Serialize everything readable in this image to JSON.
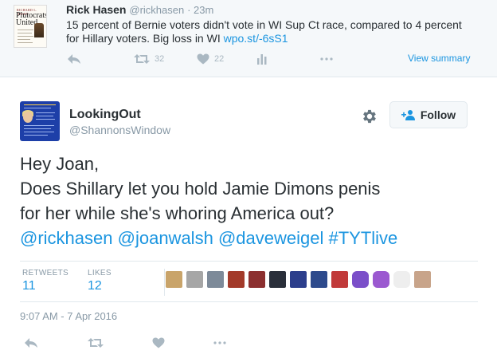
{
  "parent_tweet": {
    "avatar": {
      "author_line": "RICHARD L. HASEN",
      "title": "Plutocrats United"
    },
    "name": "Rick Hasen",
    "handle": "@rickhasen",
    "time": "· 23m",
    "text_line1": "15 percent of Bernie voters didn't vote in WI Sup Ct race, compared to 4 percent",
    "text_line2_prefix": "for Hillary voters. Big loss in WI ",
    "link": "wpo.st/-6sS1",
    "retweet_count": "32",
    "like_count": "22",
    "view_summary": "View summary",
    "icons": [
      "reply-icon",
      "retweet-icon",
      "like-icon",
      "analytics-icon",
      "more-icon"
    ]
  },
  "tweet": {
    "name": "LookingOut",
    "handle": "@ShannonsWindow",
    "follow_label": "Follow",
    "text_line1": "Hey Joan,",
    "text_line2": "Does Shillary let you hold Jamie Dimons penis",
    "text_line3": "for her while she's whoring America out?",
    "mentions": [
      "@rickhasen",
      "@joanwalsh",
      "@daveweigel",
      "#TYTlive"
    ],
    "retweets_label": "RETWEETS",
    "retweets_count": "11",
    "likes_label": "LIKES",
    "likes_count": "12",
    "liker_colors": [
      "#c9a46a",
      "#a6a6a6",
      "#7d8a99",
      "#a33a2a",
      "#8c2f2f",
      "#2a2f3a",
      "#2c3e8c",
      "#2d4a8c",
      "#c13a3a",
      "#7b4fc9",
      "#9b59d0",
      "#eeeeee",
      "#c8a48a"
    ],
    "timestamp": "9:07 AM - 7 Apr 2016",
    "icons": [
      "reply-icon",
      "retweet-icon",
      "like-icon",
      "more-icon"
    ]
  },
  "colors": {
    "link": "#1b95e0",
    "muted": "#8899a6",
    "text": "#292f33",
    "icon": "#aab8c2",
    "parent_bg": "#f5f8fa"
  }
}
